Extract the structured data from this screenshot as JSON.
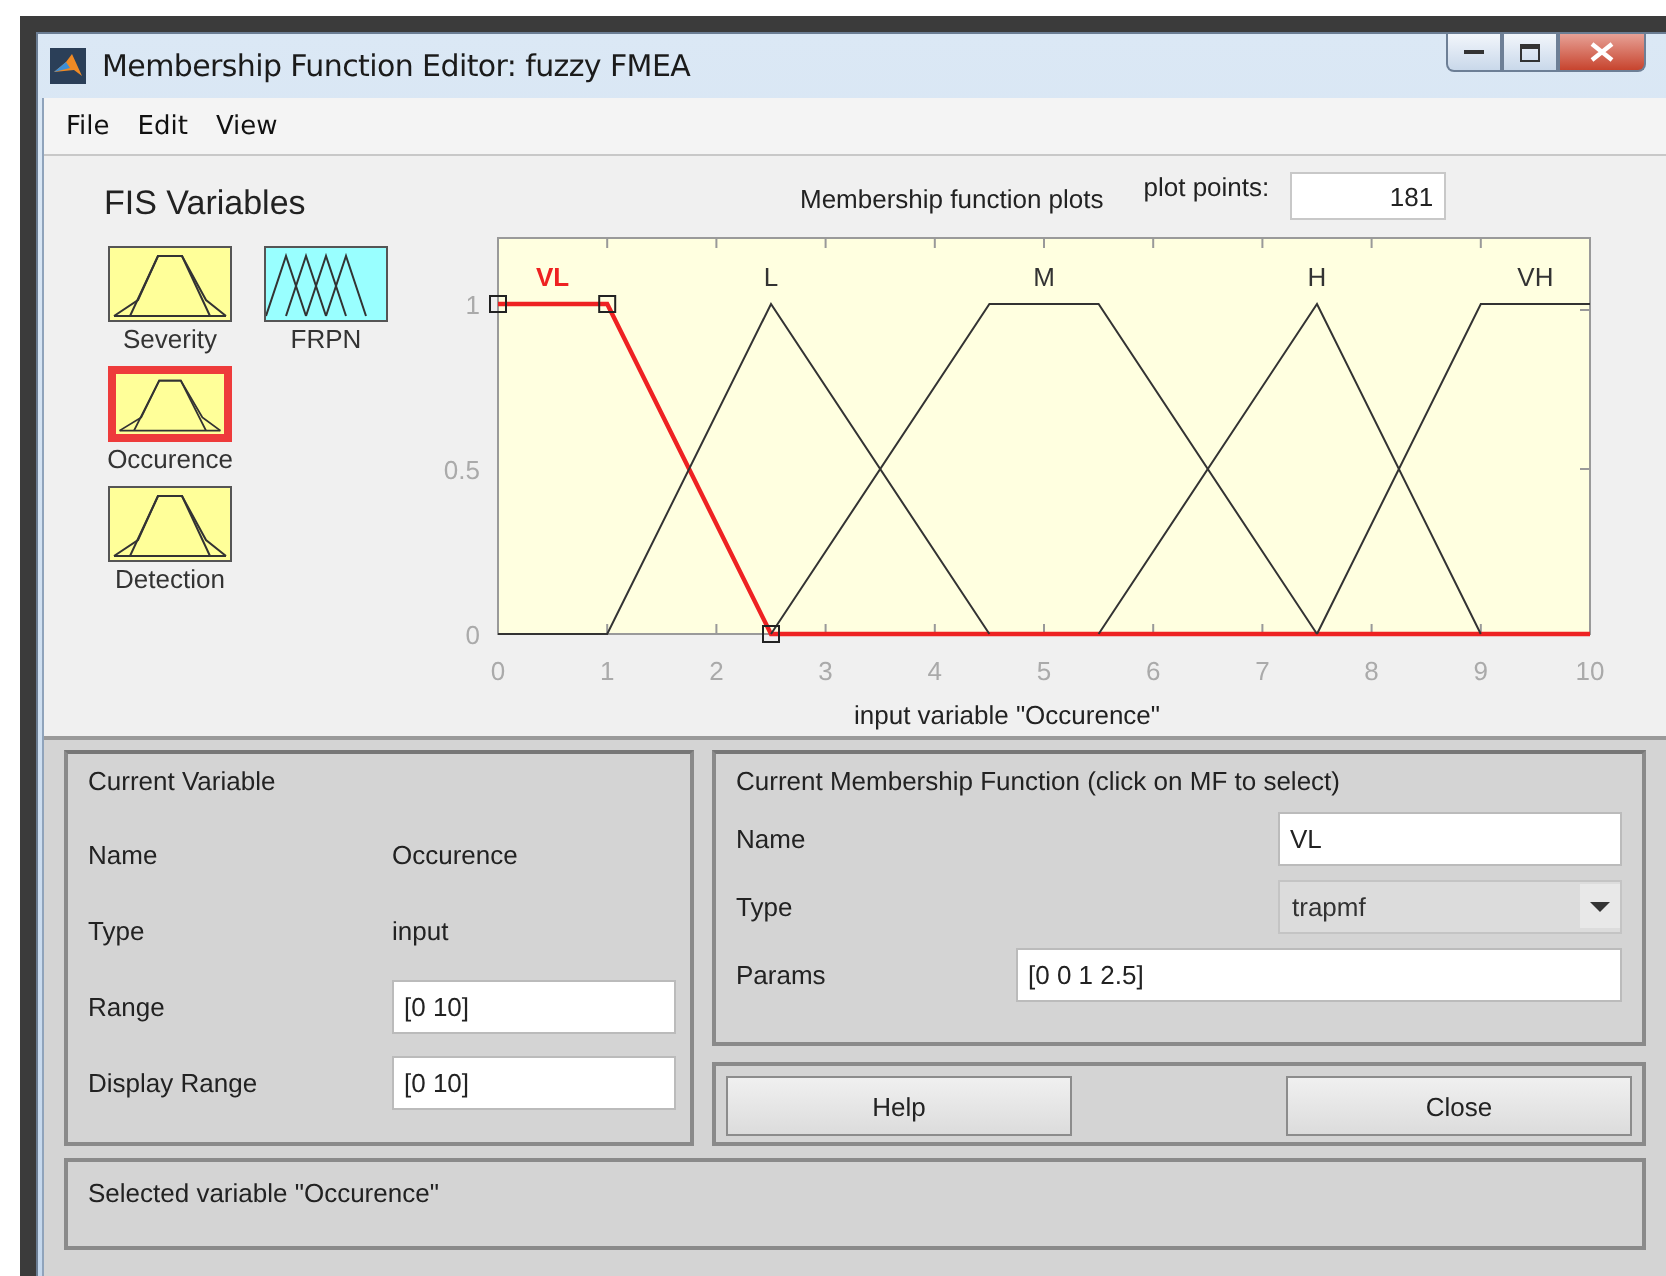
{
  "window": {
    "title": "Membership Function Editor: fuzzy FMEA"
  },
  "menu": [
    "File",
    "Edit",
    "View"
  ],
  "fis_variables": {
    "title": "FIS Variables",
    "items": [
      {
        "label": "Severity",
        "kind": "input",
        "selected": false
      },
      {
        "label": "FRPN",
        "kind": "output",
        "selected": false
      },
      {
        "label": "Occurence",
        "kind": "input",
        "selected": true
      },
      {
        "label": "Detection",
        "kind": "input",
        "selected": false
      }
    ]
  },
  "plot": {
    "title": "Membership function plots",
    "plot_points_label": "plot points:",
    "plot_points": "181",
    "chart_data": {
      "type": "line",
      "xlabel": "input variable \"Occurence\"",
      "x": [
        0,
        1,
        2.5,
        4.5,
        5.5,
        7.5,
        9,
        10
      ],
      "xlim": [
        0,
        10
      ],
      "ylim": [
        0,
        1.2
      ],
      "xticks": [
        0,
        1,
        2,
        3,
        4,
        5,
        6,
        7,
        8,
        9,
        10
      ],
      "yticks": [
        0,
        0.5,
        1
      ],
      "series": [
        {
          "name": "VL",
          "color": "#ee2222",
          "values": [
            1,
            1,
            0,
            0,
            0,
            0,
            0,
            0
          ]
        },
        {
          "name": "L",
          "color": "#333333",
          "values": [
            0,
            0,
            1,
            0,
            null,
            null,
            null,
            null
          ]
        },
        {
          "name": "M",
          "color": "#333333",
          "values": [
            null,
            null,
            0,
            1,
            1,
            0,
            null,
            null
          ]
        },
        {
          "name": "H",
          "color": "#333333",
          "values": [
            null,
            null,
            null,
            null,
            0,
            1,
            0,
            null
          ]
        },
        {
          "name": "VH",
          "color": "#333333",
          "values": [
            null,
            null,
            null,
            null,
            null,
            0,
            1,
            1
          ]
        }
      ]
    }
  },
  "current_variable": {
    "title": "Current Variable",
    "fields": [
      {
        "label": "Name",
        "value": "Occurence",
        "kind": "text"
      },
      {
        "label": "Type",
        "value": "input",
        "kind": "text"
      },
      {
        "label": "Range",
        "value": "[0 10]",
        "kind": "input"
      },
      {
        "label": "Display Range",
        "value": "[0 10]",
        "kind": "input"
      }
    ]
  },
  "current_mf": {
    "title": "Current Membership Function (click on MF to select)",
    "name_label": "Name",
    "name": "VL",
    "type_label": "Type",
    "type": "trapmf",
    "params_label": "Params",
    "params": "[0 0 1 2.5]"
  },
  "buttons": [
    "Help",
    "Close"
  ],
  "status": "Selected variable \"Occurence\""
}
